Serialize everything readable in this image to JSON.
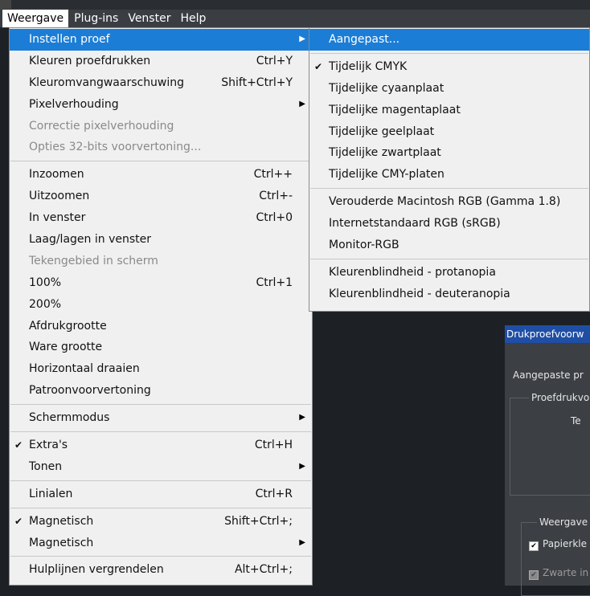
{
  "menubar": {
    "items": [
      "Weergave",
      "Plug-ins",
      "Venster",
      "Help"
    ]
  },
  "main_menu": {
    "items": [
      {
        "label": "Instellen proef",
        "shortcut": "",
        "submenu": true,
        "highlight": true
      },
      {
        "label": "Kleuren proefdrukken",
        "shortcut": "Ctrl+Y"
      },
      {
        "label": "Kleuromvangwaarschuwing",
        "shortcut": "Shift+Ctrl+Y"
      },
      {
        "label": "Pixelverhouding",
        "shortcut": "",
        "submenu": true
      },
      {
        "label": "Correctie pixelverhouding",
        "shortcut": "",
        "disabled": true
      },
      {
        "label": "Opties 32-bits voorvertoning...",
        "shortcut": "",
        "disabled": true
      },
      {
        "sep": true
      },
      {
        "label": "Inzoomen",
        "shortcut": "Ctrl++"
      },
      {
        "label": "Uitzoomen",
        "shortcut": "Ctrl+-"
      },
      {
        "label": "In venster",
        "shortcut": "Ctrl+0"
      },
      {
        "label": "Laag/lagen in venster",
        "shortcut": ""
      },
      {
        "label": "Tekengebied in scherm",
        "shortcut": "",
        "disabled": true
      },
      {
        "label": "100%",
        "shortcut": "Ctrl+1"
      },
      {
        "label": "200%",
        "shortcut": ""
      },
      {
        "label": "Afdrukgrootte",
        "shortcut": ""
      },
      {
        "label": "Ware grootte",
        "shortcut": ""
      },
      {
        "label": "Horizontaal draaien",
        "shortcut": ""
      },
      {
        "label": "Patroonvoorvertoning",
        "shortcut": ""
      },
      {
        "sep": true
      },
      {
        "label": "Schermmodus",
        "shortcut": "",
        "submenu": true
      },
      {
        "sep": true
      },
      {
        "label": "Extra's",
        "shortcut": "Ctrl+H",
        "checked": true
      },
      {
        "label": "Tonen",
        "shortcut": "",
        "submenu": true
      },
      {
        "sep": true
      },
      {
        "label": "Linialen",
        "shortcut": "Ctrl+R"
      },
      {
        "sep": true
      },
      {
        "label": "Magnetisch",
        "shortcut": "Shift+Ctrl+;",
        "checked": true
      },
      {
        "label": "Magnetisch",
        "shortcut": "",
        "submenu": true
      },
      {
        "sep": true
      },
      {
        "label": "Hulplijnen vergrendelen",
        "shortcut": "Alt+Ctrl+;"
      }
    ]
  },
  "sub_menu": {
    "items": [
      {
        "label": "Aangepast...",
        "highlight": true
      },
      {
        "sep": true
      },
      {
        "label": "Tijdelijk CMYK",
        "checked": true
      },
      {
        "label": "Tijdelijke cyaanplaat"
      },
      {
        "label": "Tijdelijke magentaplaat"
      },
      {
        "label": "Tijdelijke geelplaat"
      },
      {
        "label": "Tijdelijke zwartplaat"
      },
      {
        "label": "Tijdelijke CMY-platen"
      },
      {
        "sep": true
      },
      {
        "label": "Verouderde Macintosh RGB (Gamma 1.8)"
      },
      {
        "label": "Internetstandaard RGB (sRGB)"
      },
      {
        "label": "Monitor-RGB"
      },
      {
        "sep": true
      },
      {
        "label": "Kleurenblindheid - protanopia"
      },
      {
        "label": "Kleurenblindheid - deuteranopia"
      }
    ]
  },
  "dialog": {
    "title": "Drukproefvoorw",
    "preset_label": "Aangepaste pr",
    "group1_label": "Proefdrukvo",
    "field_label": "Te",
    "group2_label": "Weergave",
    "checkbox1": "Papierkle",
    "checkbox2": "Zwarte in"
  },
  "icons": {
    "check": "✔",
    "arrow": "▶"
  },
  "colors": {
    "highlight": "#1c7dd6",
    "menubar": "#3a3d41",
    "dialog_title": "#1f4ea5"
  }
}
